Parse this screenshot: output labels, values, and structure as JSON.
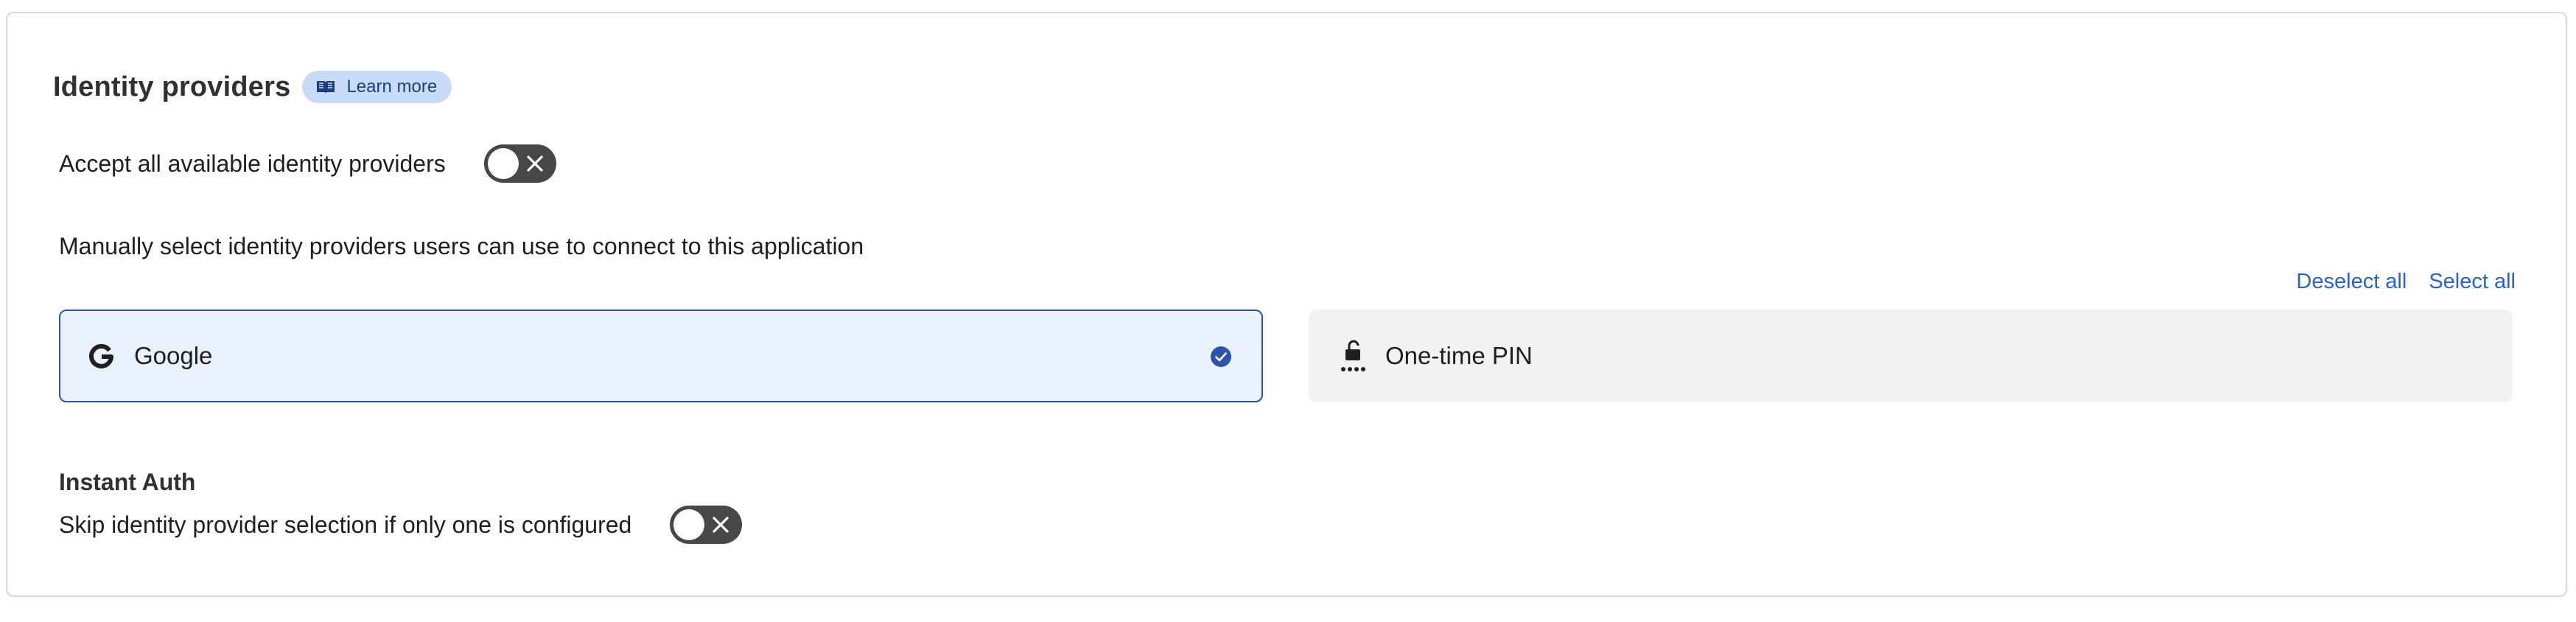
{
  "section": {
    "title": "Identity providers",
    "learn_more_label": "Learn more"
  },
  "accept_all": {
    "label": "Accept all available identity providers",
    "enabled": false
  },
  "manual_select": {
    "label": "Manually select identity providers users can use to connect to this application",
    "deselect_all_label": "Deselect all",
    "select_all_label": "Select all"
  },
  "providers": [
    {
      "name": "Google",
      "icon": "google-icon",
      "selected": true
    },
    {
      "name": "One-time PIN",
      "icon": "one-time-pin-icon",
      "selected": false
    }
  ],
  "instant_auth": {
    "title": "Instant Auth",
    "label": "Skip identity provider selection if only one is configured",
    "enabled": false
  },
  "colors": {
    "accent": "#2a64c8",
    "selected_border": "#2d54a8",
    "selected_bg": "#e9f1fc",
    "toggle_off": "#474747",
    "badge_bg": "#c9dcf7"
  }
}
